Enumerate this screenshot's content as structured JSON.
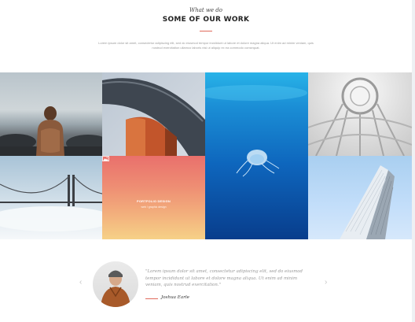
{
  "section": {
    "subtitle": "What we do",
    "title": "SOME OF OUR WORK",
    "description": "Lorem ipsum dolor sit amet, consectetur adipiscing elit, sed do eiusmod tempor incididunt ut labore et dolore magna aliqua. Ut enim ad minim veniam, quis nostrud exercitation ullamco laboris nisi ut aliquip ex ea commodo consequat."
  },
  "portfolio": {
    "overlay": {
      "title": "PORTFOLIO DESIGN",
      "category": "web / graphic design"
    }
  },
  "testimonial": {
    "quote": "\"Lorem ipsum dolor sit amet, consectetur adipiscing elit, sed do eiusmod tempor incididunt ut labore et dolore magna aliqua. Ut enim ad minim veniam, quis nostrud exercitation.\"",
    "author": "Joshua Earle",
    "prev_arrow": "‹",
    "next_arrow": "›"
  },
  "colors": {
    "accent": "#e06a5c",
    "heading": "#222222",
    "muted_text": "#999999"
  }
}
